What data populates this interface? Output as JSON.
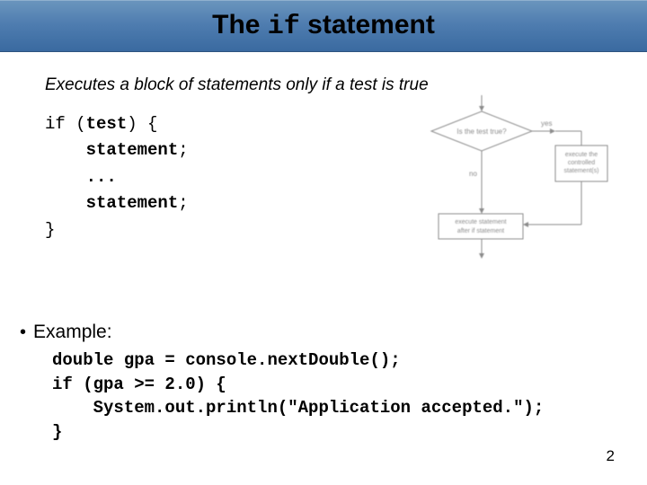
{
  "title": {
    "pre": "The ",
    "code": "if",
    "post": " statement"
  },
  "subtitle": "Executes a block of statements only if a test is true",
  "syntax": {
    "line1_a": "if (",
    "line1_b": "test",
    "line1_c": ") {",
    "line2": "statement",
    "line2_s": ";",
    "line3": "...",
    "line4": "statement",
    "line4_s": ";",
    "line5": "}"
  },
  "flowchart": {
    "test_label": "Is the test true?",
    "yes": "yes",
    "no": "no",
    "exec_box": "execute the\ncontrolled\nstatement(s)",
    "after_box": "execute statement\nafter if statement"
  },
  "example_label": "Example:",
  "example_code": "double gpa = console.nextDouble();\nif (gpa >= 2.0) {\n    System.out.println(\"Application accepted.\");\n}",
  "page_number": "2"
}
